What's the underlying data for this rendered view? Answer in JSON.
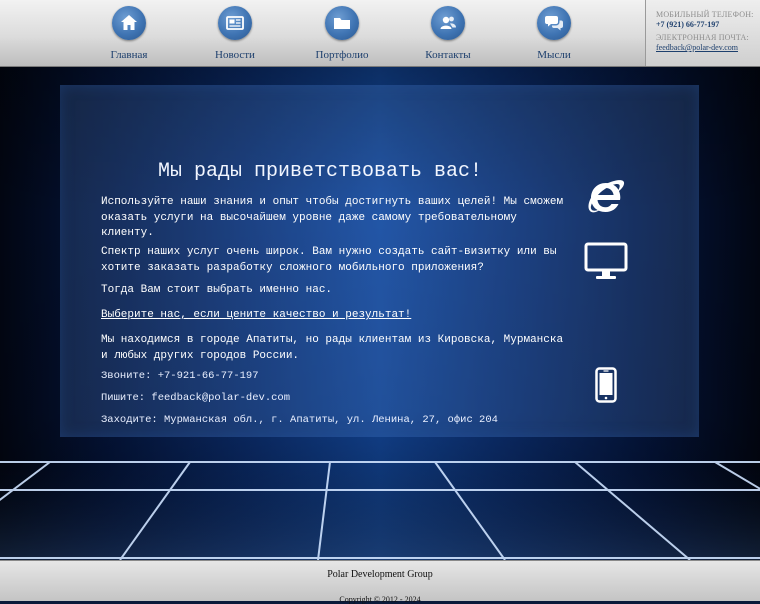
{
  "nav": {
    "items": [
      {
        "label": "Главная",
        "icon": "home-icon"
      },
      {
        "label": "Новости",
        "icon": "newspaper-icon"
      },
      {
        "label": "Портфолио",
        "icon": "folder-icon"
      },
      {
        "label": "Контакты",
        "icon": "contacts-icon"
      },
      {
        "label": "Мысли",
        "icon": "chat-bubbles-icon"
      }
    ]
  },
  "contact": {
    "phone_label": "МОБИЛЬНЫЙ ТЕЛЕФОН:",
    "phone": "+7 (921) 66-77-197",
    "email_label": "ЭЛЕКТРОННАЯ ПОЧТА:",
    "email": "feedback@polar-dev.com"
  },
  "main": {
    "title": "Мы рады приветствовать вас!",
    "p1": "Используйте наши знания и опыт чтобы достигнуть ваших целей! Мы сможем оказать услуги на высочайшем уровне даже самому требовательному клиенту.",
    "p2": "Спектр наших услуг очень широк. Вам нужно создать сайт-визитку или вы хотите заказать разработку сложного мобильного приложения?",
    "p3": "Тогда Вам стоит выбрать именно нас.",
    "p4": "Выберите нас, если цените качество и результат!",
    "p5": "Мы находимся в городе Апатиты, но рады клиентам из Кировска, Мурманска и любых других городов России.",
    "call": "Звоните: +7-921-66-77-197",
    "write": "Пишите: feedback@polar-dev.com",
    "visit": "Заходите: Мурманская обл., г. Апатиты, ул. Ленина, 27, офис 204"
  },
  "side_icons": [
    "internet-explorer-icon",
    "desktop-monitor-icon",
    "smartphone-icon"
  ],
  "footer": {
    "company": "Polar Development Group",
    "copyright": "Copyright © 2012 - 2024"
  },
  "colors": {
    "accent": "#3f74b3",
    "nav_text": "#1d3f6d",
    "background": "#0b2c6b"
  }
}
